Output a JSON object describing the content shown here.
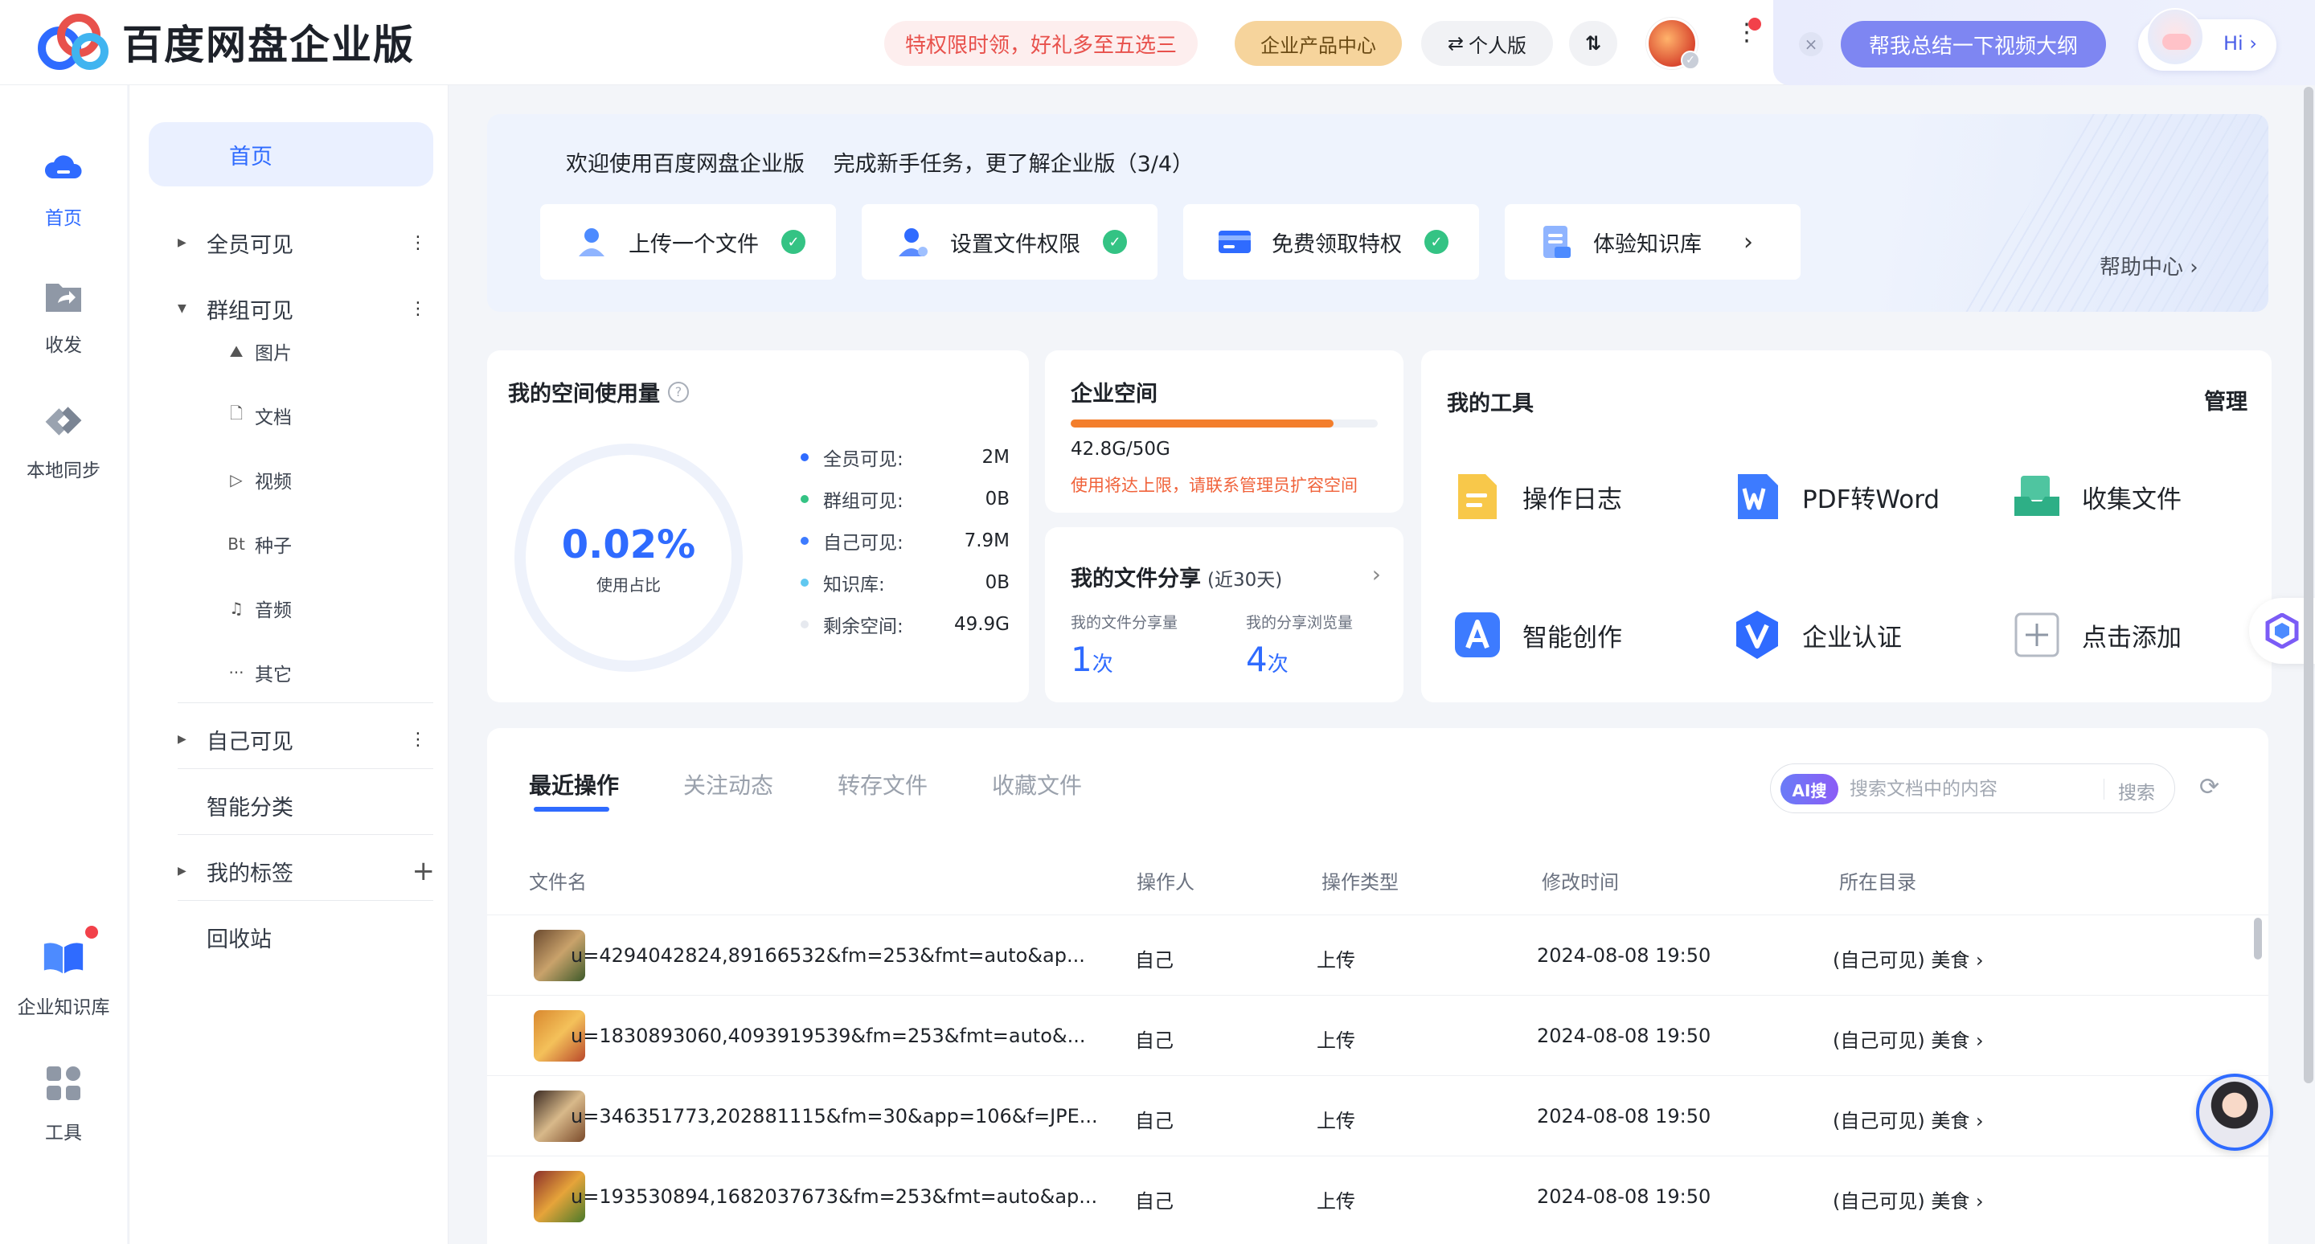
{
  "app": {
    "logo_text": "百度网盘企业版"
  },
  "topbar": {
    "promo": "特权限时领，好礼多至五选三",
    "product_center": "企业产品中心",
    "personal": "个人版",
    "switch": "⇅",
    "ai_ask": "帮我总结一下视频大纲",
    "hi": "Hi ›"
  },
  "leftnav": [
    {
      "label": "首页",
      "icon": "cloud-icon"
    },
    {
      "label": "收发",
      "icon": "share-folder-icon"
    },
    {
      "label": "本地同步",
      "icon": "sync-icon"
    },
    {
      "label": "企业知识库",
      "icon": "book-icon"
    },
    {
      "label": "工具",
      "icon": "grid-icon"
    }
  ],
  "tree": {
    "home": "首页",
    "all_visible": "全员可见",
    "group_visible": "群组可见",
    "sub": [
      "图片",
      "文档",
      "视频",
      "种子",
      "音频",
      "其它"
    ],
    "sub_icons": [
      "⛰",
      "🗋",
      "▷",
      "Bt",
      "♫",
      "···"
    ],
    "self_visible": "自己可见",
    "smart": "智能分类",
    "tags": "我的标签",
    "trash": "回收站"
  },
  "welcome": {
    "title": "欢迎使用百度网盘企业版　 完成新手任务，更了解企业版（3/4）",
    "tasks": [
      "上传一个文件",
      "设置文件权限",
      "免费领取特权",
      "体验知识库"
    ],
    "help": "帮助中心 ›"
  },
  "space": {
    "title": "我的空间使用量",
    "percent": "0.02%",
    "percent_label": "使用占比",
    "legend": [
      {
        "key": "全员可见:",
        "value": "2M",
        "color": "#2f6bff"
      },
      {
        "key": "群组可见:",
        "value": "0B",
        "color": "#34c384"
      },
      {
        "key": "自己可见:",
        "value": "7.9M",
        "color": "#3d7bff"
      },
      {
        "key": "知识库:",
        "value": "0B",
        "color": "#60c8f0"
      },
      {
        "key": "剩余空间:",
        "value": "49.9G",
        "color": "#e6e9ef"
      }
    ]
  },
  "enterprise": {
    "title": "企业空间",
    "used": "42.8G/50G",
    "used_fraction": 0.856,
    "warning": "使用将达上限，请联系管理员扩容空间"
  },
  "share": {
    "title": "我的文件分享",
    "period": "(近30天)",
    "count_label": "我的文件分享量",
    "count": "1",
    "views_label": "我的分享浏览量",
    "views": "4",
    "unit": "次"
  },
  "tools": {
    "title": "我的工具",
    "manage": "管理",
    "items": [
      "操作日志",
      "PDF转Word",
      "收集文件",
      "智能创作",
      "企业认证",
      "点击添加"
    ]
  },
  "recent": {
    "tabs": [
      "最近操作",
      "关注动态",
      "转存文件",
      "收藏文件"
    ],
    "search_badge": "AI搜",
    "search_placeholder": "搜索文档中的内容",
    "search_btn": "搜索",
    "columns": [
      "文件名",
      "操作人",
      "操作类型",
      "修改时间",
      "所在目录"
    ],
    "rows": [
      {
        "name": "u=4294042824,89166532&fm=253&fmt=auto&ap...",
        "op": "自己",
        "type": "上传",
        "time": "2024-08-08 19:50",
        "dir": "(自己可见) 美食 ›"
      },
      {
        "name": "u=1830893060,4093919539&fm=253&fmt=auto&...",
        "op": "自己",
        "type": "上传",
        "time": "2024-08-08 19:50",
        "dir": "(自己可见) 美食 ›"
      },
      {
        "name": "u=346351773,202881115&fm=30&app=106&f=JPE...",
        "op": "自己",
        "type": "上传",
        "time": "2024-08-08 19:50",
        "dir": "(自己可见) 美食 ›"
      },
      {
        "name": "u=193530894,1682037673&fm=253&fmt=auto&ap...",
        "op": "自己",
        "type": "上传",
        "time": "2024-08-08 19:50",
        "dir": "(自己可见) 美食 ›"
      }
    ]
  }
}
